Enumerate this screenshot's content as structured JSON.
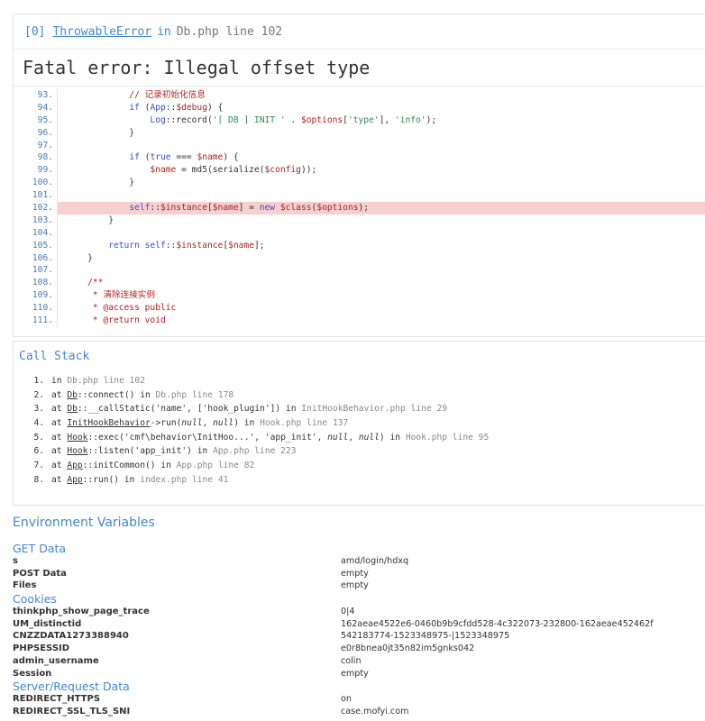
{
  "exception": {
    "index": "[0]",
    "class_name": "ThrowableError",
    "in_word": "in",
    "location": "Db.php line 102",
    "message": "Fatal error: Illegal offset type"
  },
  "source_lines": [
    {
      "no": "93.",
      "code": "            // 记录初始化信息"
    },
    {
      "no": "94.",
      "code": "            if (App::$debug) {"
    },
    {
      "no": "95.",
      "code": "                Log::record('[ DB ] INIT ' . $options['type'], 'info');"
    },
    {
      "no": "96.",
      "code": "            }"
    },
    {
      "no": "97.",
      "code": ""
    },
    {
      "no": "98.",
      "code": "            if (true === $name) {"
    },
    {
      "no": "99.",
      "code": "                $name = md5(serialize($config));"
    },
    {
      "no": "100.",
      "code": "            }"
    },
    {
      "no": "101.",
      "code": ""
    },
    {
      "no": "102.",
      "code": "            self::$instance[$name] = new $class($options);",
      "highlight": true
    },
    {
      "no": "103.",
      "code": "        }"
    },
    {
      "no": "104.",
      "code": ""
    },
    {
      "no": "105.",
      "code": "        return self::$instance[$name];"
    },
    {
      "no": "106.",
      "code": "    }"
    },
    {
      "no": "107.",
      "code": ""
    },
    {
      "no": "108.",
      "code": "    /**"
    },
    {
      "no": "109.",
      "code": "     * 清除连接实例"
    },
    {
      "no": "110.",
      "code": "     * @access public"
    },
    {
      "no": "111.",
      "code": "     * @return void"
    }
  ],
  "call_stack": {
    "title": "Call Stack",
    "items": [
      {
        "n": "1.",
        "pre": "in ",
        "fn": "",
        "args": "",
        "file": "Db.php line 102"
      },
      {
        "n": "2.",
        "pre": "at ",
        "fn": "Db",
        "args": "::connect() in ",
        "file": "Db.php line 178"
      },
      {
        "n": "3.",
        "pre": "at ",
        "fn": "Db",
        "args": "::__callStatic('name', ['hook_plugin']) in ",
        "file": "InitHookBehavior.php line 29"
      },
      {
        "n": "4.",
        "pre": "at ",
        "fn": "InitHookBehavior",
        "args": "->run(null, null) in ",
        "file": "Hook.php line 137"
      },
      {
        "n": "5.",
        "pre": "at ",
        "fn": "Hook",
        "args": "::exec('cmf\\behavior\\InitHoo...', 'app_init', null, null) in ",
        "file": "Hook.php line 95"
      },
      {
        "n": "6.",
        "pre": "at ",
        "fn": "Hook",
        "args": "::listen('app_init') in ",
        "file": "App.php line 223"
      },
      {
        "n": "7.",
        "pre": "at ",
        "fn": "App",
        "args": "::initCommon() in ",
        "file": "App.php line 82"
      },
      {
        "n": "8.",
        "pre": "at ",
        "fn": "App",
        "args": "::run() in ",
        "file": "index.php line 41"
      }
    ]
  },
  "environment": {
    "title": "Environment Variables",
    "rows": [
      {
        "section": "GET Data"
      },
      {
        "key": "s",
        "value": "amd/login/hdxq"
      },
      {
        "key": "POST Data",
        "value": "empty"
      },
      {
        "key": "Files",
        "value": "empty"
      },
      {
        "section": "Cookies"
      },
      {
        "key": "thinkphp_show_page_trace",
        "value": "0|4"
      },
      {
        "key": "UM_distinctid",
        "value": "162aeae4522e6-0460b9b9cfdd528-4c322073-232800-162aeae452462f"
      },
      {
        "key": "CNZZDATA1273388940",
        "value": "542183774-1523348975-|1523348975"
      },
      {
        "key": "PHPSESSID",
        "value": "e0r8bnea0jt35n82im5gnks042"
      },
      {
        "key": "admin_username",
        "value": "colin"
      },
      {
        "key": "Session",
        "value": "empty"
      },
      {
        "section": "Server/Request Data"
      },
      {
        "key": "REDIRECT_HTTPS",
        "value": "on"
      },
      {
        "key": "REDIRECT_SSL_TLS_SNI",
        "value": "case.mofyi.com"
      }
    ]
  }
}
